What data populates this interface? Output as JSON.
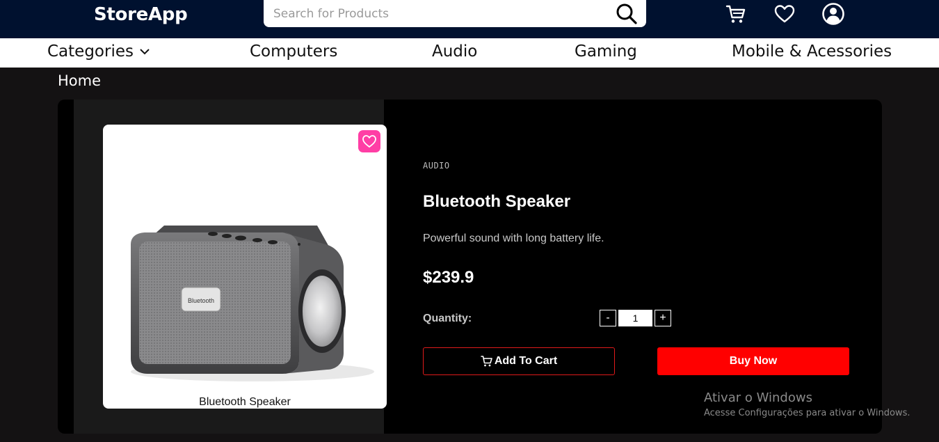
{
  "header": {
    "logo": "StoreApp",
    "search_placeholder": "Search for Products",
    "icons": [
      "search-icon",
      "cart-icon",
      "heart-icon",
      "user-account-icon"
    ]
  },
  "nav": {
    "categories_label": "Categories",
    "items": [
      "Computers",
      "Audio",
      "Gaming",
      "Mobile & Acessories"
    ]
  },
  "breadcrumb": "Home",
  "product": {
    "category": "AUDIO",
    "name": "Bluetooth Speaker",
    "image_caption": "Bluetooth Speaker",
    "image_badge_text": "Bluetooth",
    "description": "Powerful sound with long battery life.",
    "price": "$239.9",
    "quantity_label": "Quantity:",
    "quantity_value": "1",
    "decrement_label": "-",
    "increment_label": "+",
    "add_to_cart_label": "Add To Cart",
    "buy_now_label": "Buy Now"
  },
  "watermark": {
    "title": "Ativar o Windows",
    "subtitle": "Acesse Configurações para ativar o Windows."
  },
  "colors": {
    "header_bg": "#00112f",
    "page_bg": "#141213",
    "card_bg": "#000000",
    "favorite_pink": "#ff3ea5",
    "buy_now_red": "#ff0000",
    "add_to_cart_border": "#e01a1a"
  }
}
